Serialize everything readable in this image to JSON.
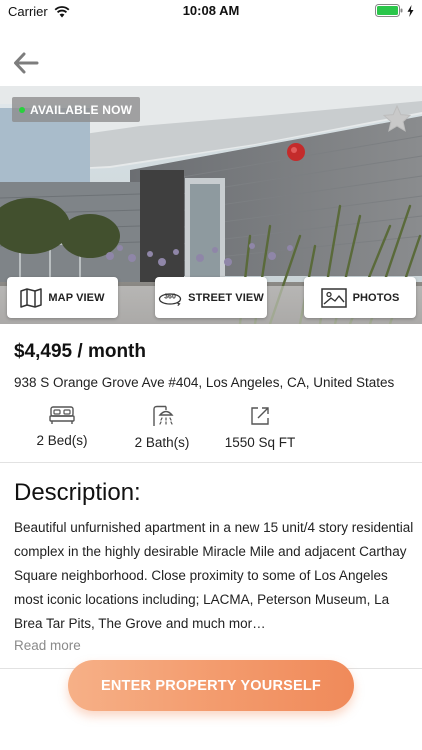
{
  "status_bar": {
    "carrier": "Carrier",
    "time": "10:08 AM",
    "battery_color": "#2ac64a"
  },
  "nav": {
    "back_icon": "arrow-left-icon"
  },
  "listing": {
    "availability": "AVAILABLE NOW",
    "availability_color": "#27d13c",
    "favorite_icon": "star-icon",
    "price": "$4,495 / month",
    "address": "938 S Orange Grove Ave #404, Los Angeles, CA, United States",
    "features": [
      {
        "icon": "bed-icon",
        "label": "2 Bed(s)"
      },
      {
        "icon": "shower-icon",
        "label": "2 Bath(s)"
      },
      {
        "icon": "expand-icon",
        "label": "1550 Sq FT"
      }
    ]
  },
  "view_buttons": {
    "map": "MAP VIEW",
    "street": "STREET VIEW",
    "photos": "PHOTOS"
  },
  "description": {
    "title": "Description:",
    "text": "Beautiful unfurnished apartment  in a new 15 unit/4 story residential complex in the highly desirable Miracle Mile and adjacent Carthay Square neighborhood. Close proximity to some of Los Angeles most iconic locations including; LACMA, Peterson Museum, La Brea Tar Pits, The Grove and much mor…",
    "read_more": "Read more"
  },
  "cta": {
    "label": "ENTER PROPERTY YOURSELF",
    "color": "#f39a6c"
  }
}
